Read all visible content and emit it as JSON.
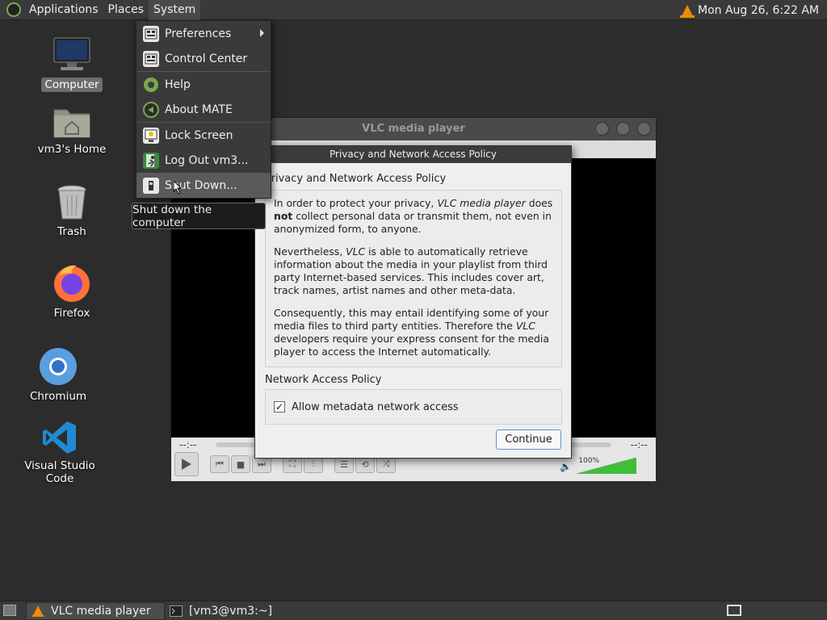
{
  "top_panel": {
    "menus": [
      "Applications",
      "Places",
      "System"
    ],
    "clock": "Mon Aug 26,  6:22 AM",
    "tray_icon": "vlc-cone-icon"
  },
  "desktop_icons": [
    {
      "label": "Computer",
      "icon": "computer-icon",
      "selected": true
    },
    {
      "label": "vm3's Home",
      "icon": "home-folder-icon"
    },
    {
      "label": "Trash",
      "icon": "trash-icon"
    },
    {
      "label": "Firefox",
      "icon": "firefox-icon"
    },
    {
      "label": "Chromium",
      "icon": "chromium-icon"
    },
    {
      "label": "Visual Studio Code",
      "icon": "vscode-icon"
    }
  ],
  "system_menu": {
    "items": [
      {
        "label": "Preferences",
        "icon": "preferences-icon",
        "submenu": true
      },
      {
        "label": "Control Center",
        "icon": "control-center-icon"
      },
      {
        "label": "Help",
        "icon": "help-icon"
      },
      {
        "label": "About MATE",
        "icon": "about-mate-icon"
      },
      {
        "label": "Lock Screen",
        "icon": "lock-screen-icon"
      },
      {
        "label": "Log Out vm3...",
        "icon": "log-out-icon"
      },
      {
        "label": "Shut Down...",
        "icon": "shut-down-icon",
        "hovered": true
      }
    ],
    "tooltip": "Shut down the computer"
  },
  "vlc": {
    "title": "VLC media player",
    "elapsed": "--:--",
    "remaining": "--:--",
    "volume": "100%",
    "volume_level": 1.0,
    "controls": [
      "play-icon",
      "previous-icon",
      "stop-icon",
      "next-icon",
      "fullscreen-icon",
      "extended-settings-icon",
      "playlist-icon",
      "loop-icon",
      "shuffle-icon",
      "speaker-icon"
    ]
  },
  "dialog": {
    "title": "Privacy and Network Access Policy",
    "heading": "Privacy and Network Access Policy",
    "para1_a": "In order to protect your privacy, ",
    "para1_em": "VLC media player",
    "para1_b": " does ",
    "para1_strong": "not",
    "para1_c": " collect personal data or transmit them, not even in anonymized form, to anyone.",
    "para2_a": "Nevertheless, ",
    "para2_em": "VLC",
    "para2_b": " is able to automatically retrieve information about the media in your playlist from third party Internet-based services. This includes cover art, track names, artist names and other meta-data.",
    "para3_a": "Consequently, this may entail identifying some of your media files to third party entities. Therefore the ",
    "para3_em": "VLC",
    "para3_b": " developers require your express consent for the media player to access the Internet automatically.",
    "network_heading": "Network Access Policy",
    "checkbox_label": "Allow metadata network access",
    "checkbox_checked": "✓",
    "continue_label": "Continue"
  },
  "taskbar": {
    "items": [
      {
        "label": "VLC media player",
        "icon": "vlc-cone-icon",
        "active": true
      },
      {
        "label": "[vm3@vm3:~]",
        "icon": "terminal-icon",
        "active": false
      }
    ]
  }
}
